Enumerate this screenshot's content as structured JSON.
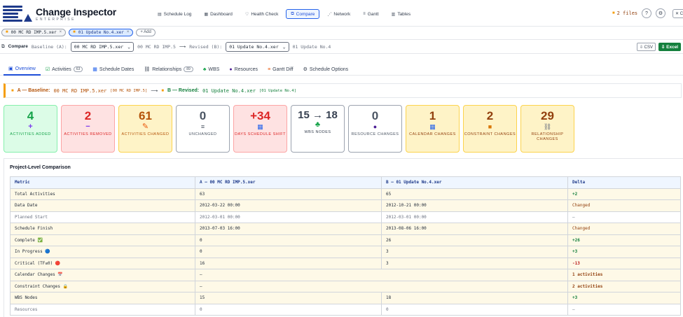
{
  "app": {
    "title": "Change Inspector",
    "subtitle": "ENTERPRISE"
  },
  "nav": [
    {
      "label": "Schedule Log",
      "icon": "doc-icon"
    },
    {
      "label": "Dashboard",
      "icon": "dashboard-icon"
    },
    {
      "label": "Health Check",
      "icon": "heart-icon"
    },
    {
      "label": "Compare",
      "icon": "compare-icon",
      "active": true
    },
    {
      "label": "Network",
      "icon": "network-icon"
    },
    {
      "label": "Gantt",
      "icon": "gantt-icon"
    },
    {
      "label": "Tables",
      "icon": "table-icon"
    }
  ],
  "header_right": {
    "files_label": "2 files",
    "help_label": "?",
    "settings_label": "⚙",
    "close_label": "✕ Clo"
  },
  "file_tabs": [
    {
      "label": "00 MC RD IMP.5.xer",
      "active": false
    },
    {
      "label": "01 Update No.4.xer",
      "active": true
    }
  ],
  "add_label": "+ Add",
  "compare": {
    "title": "Compare",
    "baseline_label": "Baseline (A):",
    "baseline_value": "00 MC RD IMP.5.xer",
    "baseline_name": "00 MC RD IMP.5",
    "arrow": "⟶",
    "revised_label": "Revised (B):",
    "revised_value": "01 Update No.4.xer",
    "revised_name": "01 Update No.4",
    "csv_label": "⇩ CSV",
    "excel_label": "⇩ Excel"
  },
  "subtabs": [
    {
      "label": "Overview",
      "active": true
    },
    {
      "label": "Activities",
      "pill": "63"
    },
    {
      "label": "Schedule Dates"
    },
    {
      "label": "Relationships",
      "pill": "89"
    },
    {
      "label": "WBS"
    },
    {
      "label": "Resources"
    },
    {
      "label": "Gantt Diff"
    },
    {
      "label": "Schedule Options"
    }
  ],
  "ab_strip": {
    "a_label": "A — Baseline:",
    "a_file": "00 MC RD IMP.5.xer",
    "a_tag": "[00 MC RD IMP.5]",
    "arrow": "⟶",
    "b_label": "B — Revised:",
    "b_file": "01 Update No.4.xer",
    "b_tag": "[01 Update No.4]"
  },
  "cards": [
    {
      "value": "4",
      "icon": "plus-icon",
      "label": "ACTIVITIES ADDED",
      "color": "#16a34a"
    },
    {
      "value": "2",
      "icon": "minus-icon",
      "label": "ACTIVITIES REMOVED",
      "color": "#dc2626"
    },
    {
      "value": "61",
      "icon": "pencil-icon",
      "label": "ACTIVITIES CHANGED",
      "color": "#b45309"
    },
    {
      "value": "0",
      "icon": "equals-icon",
      "label": "UNCHANGED",
      "color": "#4b5563"
    },
    {
      "value": "+34",
      "icon": "calendar-icon",
      "label": "DAYS SCHEDULE SHIFT",
      "color": "#dc2626"
    },
    {
      "value": "15 → 18",
      "icon": "tree-icon",
      "label": "WBS NODES",
      "color": "#374151"
    },
    {
      "value": "0",
      "icon": "person-icon",
      "label": "RESOURCE CHANGES",
      "color": "#4b5563"
    },
    {
      "value": "1",
      "icon": "calendar-icon",
      "label": "CALENDAR CHANGES",
      "color": "#92400e"
    },
    {
      "value": "2",
      "icon": "lock-icon",
      "label": "CONSTRAINT CHANGES",
      "color": "#92400e"
    },
    {
      "value": "29",
      "icon": "link-icon",
      "label": "RELATIONSHIP CHANGES",
      "color": "#92400e"
    }
  ],
  "table": {
    "title": "Project-Level Comparison",
    "headers": [
      "Metric",
      "A — 00 MC RD IMP.5.xer",
      "B — 01 Update No.4.xer",
      "Delta"
    ],
    "rows": [
      {
        "metric": "Total Activities",
        "a": "63",
        "b": "65",
        "delta": "+2",
        "hl": true,
        "dclass": "d-pos"
      },
      {
        "metric": "Data Date",
        "a": "2012-03-22 00:00",
        "b": "2012-10-21 00:00",
        "delta": "Changed",
        "hl": true,
        "dclass": "d-chg"
      },
      {
        "metric": "Planned Start",
        "a": "2012-03-01 00:00",
        "b": "2012-03-01 00:00",
        "delta": "—",
        "hl": false,
        "dclass": "grey"
      },
      {
        "metric": "Schedule Finish",
        "a": "2013-07-03 16:00",
        "b": "2013-08-06 16:00",
        "delta": "Changed",
        "hl": true,
        "dclass": "d-chg"
      },
      {
        "metric": "Complete ✅",
        "a": "0",
        "b": "26",
        "delta": "+26",
        "hl": true,
        "dclass": "d-pos"
      },
      {
        "metric": "In Progress 🔵",
        "a": "0",
        "b": "3",
        "delta": "+3",
        "hl": true,
        "dclass": "d-pos"
      },
      {
        "metric": "Critical (TF≤0) 🔴",
        "a": "16",
        "b": "3",
        "delta": "-13",
        "hl": true,
        "dclass": "d-neg"
      },
      {
        "metric": "Calendar Changes 📅",
        "a": "—",
        "b": "",
        "delta": "1 activities",
        "hl": true,
        "dclass": "d-bold",
        "span": true
      },
      {
        "metric": "Constraint Changes 🔒",
        "a": "—",
        "b": "",
        "delta": "2 activities",
        "hl": true,
        "dclass": "d-bold",
        "span": true
      },
      {
        "metric": "WBS Nodes",
        "a": "15",
        "b": "18",
        "delta": "+3",
        "hl": true,
        "dclass": "d-pos"
      },
      {
        "metric": "Resources",
        "a": "0",
        "b": "0",
        "delta": "—",
        "hl": false,
        "dclass": "grey"
      }
    ]
  }
}
